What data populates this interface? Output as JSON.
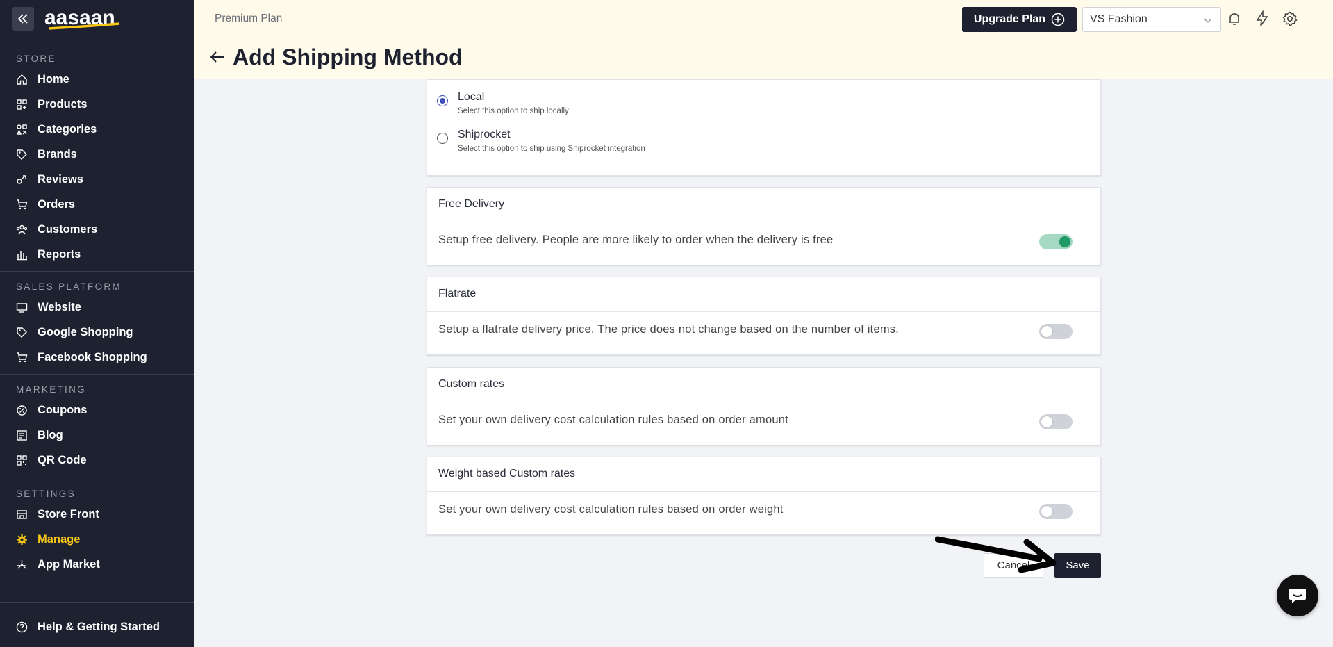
{
  "sidebar": {
    "logo_text": "aasaan",
    "sections": [
      {
        "title": "STORE",
        "items": [
          {
            "label": "Home",
            "icon": "home-icon"
          },
          {
            "label": "Products",
            "icon": "grid-icon"
          },
          {
            "label": "Categories",
            "icon": "shapes-icon"
          },
          {
            "label": "Brands",
            "icon": "tag-icon"
          },
          {
            "label": "Reviews",
            "icon": "review-icon"
          },
          {
            "label": "Orders",
            "icon": "cart-icon"
          },
          {
            "label": "Customers",
            "icon": "users-icon"
          },
          {
            "label": "Reports",
            "icon": "bar-chart-icon"
          }
        ]
      },
      {
        "title": "SALES PLATFORM",
        "items": [
          {
            "label": "Website",
            "icon": "monitor-icon"
          },
          {
            "label": "Google Shopping",
            "icon": "tag-icon"
          },
          {
            "label": "Facebook Shopping",
            "icon": "cart-icon"
          }
        ]
      },
      {
        "title": "MARKETING",
        "items": [
          {
            "label": "Coupons",
            "icon": "coupon-icon"
          },
          {
            "label": "Blog",
            "icon": "document-icon"
          },
          {
            "label": "QR Code",
            "icon": "qr-icon"
          }
        ]
      },
      {
        "title": "SETTINGS",
        "items": [
          {
            "label": "Store Front",
            "icon": "storefront-icon"
          },
          {
            "label": "Manage",
            "icon": "gear-icon",
            "active": true
          },
          {
            "label": "App Market",
            "icon": "app-icon"
          }
        ]
      }
    ],
    "help_label": "Help & Getting Started",
    "active_color": "#f5c518"
  },
  "header": {
    "plan": "Premium Plan",
    "page_title": "Add Shipping Method",
    "upgrade_label": "Upgrade Plan",
    "store_name": "VS Fashion"
  },
  "shipping_type": {
    "options": [
      {
        "title": "Local",
        "desc": "Select this option to ship locally",
        "selected": true
      },
      {
        "title": "Shiprocket",
        "desc": "Select this option to ship using Shiprocket integration",
        "selected": false
      }
    ]
  },
  "cards": [
    {
      "title": "Free Delivery",
      "desc": "Setup free delivery. People are more likely to order when the delivery is free",
      "enabled": true
    },
    {
      "title": "Flatrate",
      "desc": "Setup a flatrate delivery price. The price does not change based on the number of items.",
      "enabled": false
    },
    {
      "title": "Custom rates",
      "desc": "Set your own delivery cost calculation rules based on order amount",
      "enabled": false
    },
    {
      "title": "Weight based Custom rates",
      "desc": "Set your own delivery cost calculation rules based on order weight",
      "enabled": false
    }
  ],
  "actions": {
    "cancel_label": "Cancel",
    "save_label": "Save"
  },
  "colors": {
    "sidebar_bg": "#1e2130",
    "header_bg": "#fefbea",
    "toggle_on": "#1e9a66",
    "radio_selected": "#3d4eb8"
  }
}
